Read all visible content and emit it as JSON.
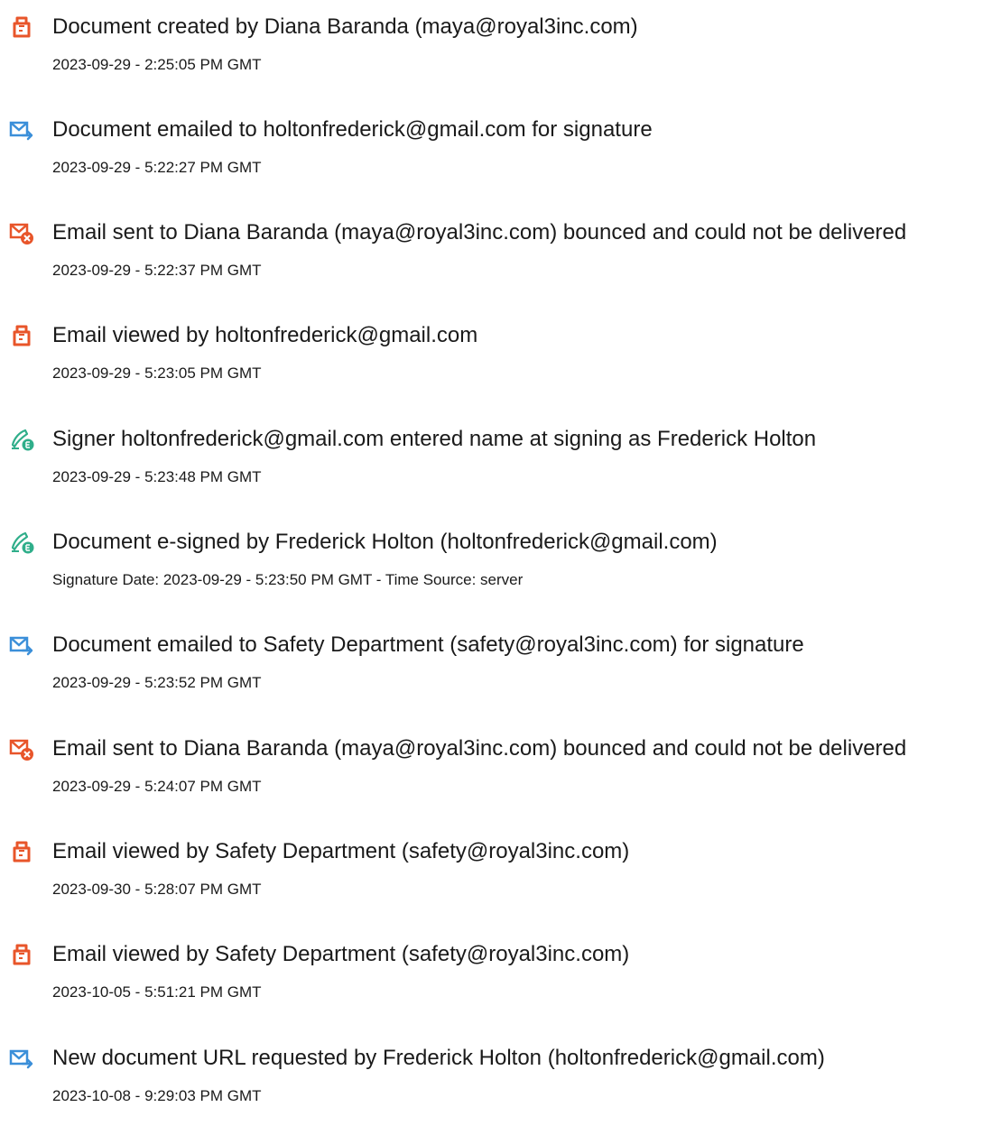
{
  "colors": {
    "text": "#1a1a1a",
    "doc_icon": "#e8552a",
    "mail_icon": "#3b8fd9",
    "bounce_badge": "#e8552a",
    "sign_icon": "#2fae8a"
  },
  "events": [
    {
      "icon": "document-icon",
      "title": "Document created by Diana Baranda (maya@royal3inc.com)",
      "time": "2023-09-29 - 2:25:05 PM GMT"
    },
    {
      "icon": "email-sent-icon",
      "title": "Document emailed to holtonfrederick@gmail.com for signature",
      "time": "2023-09-29 - 5:22:27 PM GMT"
    },
    {
      "icon": "email-bounced-icon",
      "title": "Email sent to Diana Baranda (maya@royal3inc.com) bounced and could not be delivered",
      "time": "2023-09-29 - 5:22:37 PM GMT"
    },
    {
      "icon": "document-icon",
      "title": "Email viewed by holtonfrederick@gmail.com",
      "time": "2023-09-29 - 5:23:05 PM GMT"
    },
    {
      "icon": "e-sign-icon",
      "title": "Signer holtonfrederick@gmail.com entered name at signing as Frederick Holton",
      "time": "2023-09-29 - 5:23:48 PM GMT"
    },
    {
      "icon": "e-sign-icon",
      "title": "Document e-signed by Frederick Holton (holtonfrederick@gmail.com)",
      "time": "Signature Date: 2023-09-29 - 5:23:50 PM GMT - Time Source: server"
    },
    {
      "icon": "email-sent-icon",
      "title": "Document emailed to Safety Department (safety@royal3inc.com) for signature",
      "time": "2023-09-29 - 5:23:52 PM GMT"
    },
    {
      "icon": "email-bounced-icon",
      "title": "Email sent to Diana Baranda (maya@royal3inc.com) bounced and could not be delivered",
      "time": "2023-09-29 - 5:24:07 PM GMT"
    },
    {
      "icon": "document-icon",
      "title": "Email viewed by Safety Department (safety@royal3inc.com)",
      "time": "2023-09-30 - 5:28:07 PM GMT"
    },
    {
      "icon": "document-icon",
      "title": "Email viewed by Safety Department (safety@royal3inc.com)",
      "time": "2023-10-05 - 5:51:21 PM GMT"
    },
    {
      "icon": "email-sent-icon",
      "title": "New document URL requested by Frederick Holton (holtonfrederick@gmail.com)",
      "time": "2023-10-08 - 9:29:03 PM GMT"
    }
  ]
}
